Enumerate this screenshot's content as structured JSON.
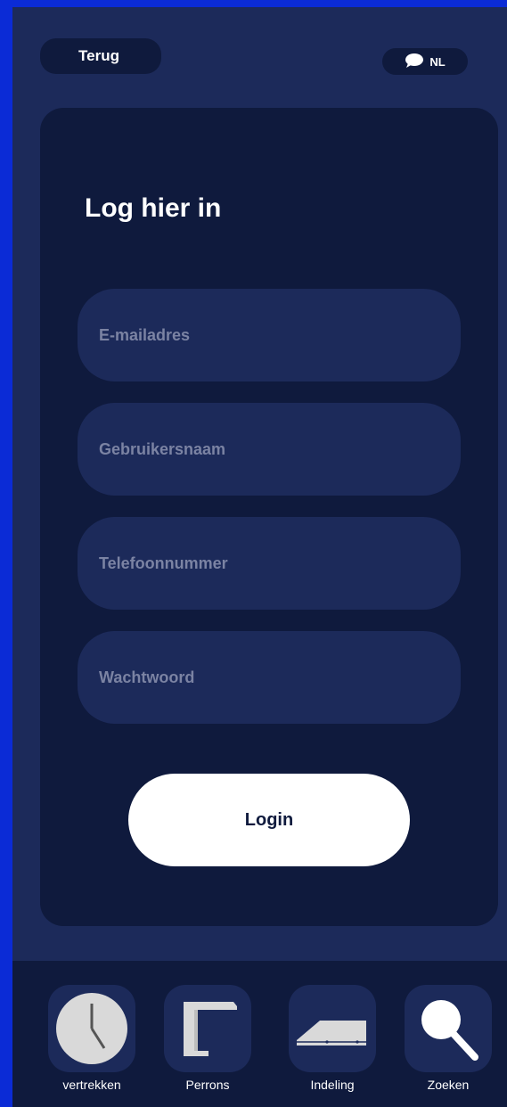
{
  "header": {
    "back_label": "Terug",
    "language_label": "NL"
  },
  "login": {
    "title": "Log hier in",
    "email_placeholder": "E-mailadres",
    "username_placeholder": "Gebruikersnaam",
    "phone_placeholder": "Telefoonnummer",
    "password_placeholder": "Wachtwoord",
    "submit_label": "Login"
  },
  "bottom_nav": {
    "items": [
      {
        "label": "vertrekken",
        "icon": "clock-icon"
      },
      {
        "label": "Perrons",
        "icon": "platform-icon"
      },
      {
        "label": "Indeling",
        "icon": "train-icon"
      },
      {
        "label": "Zoeken",
        "icon": "search-icon"
      }
    ]
  },
  "colors": {
    "background": "#1c2a5a",
    "card": "#0f1a3d",
    "accent_edge": "#0b2bd6",
    "button": "#ffffff"
  }
}
